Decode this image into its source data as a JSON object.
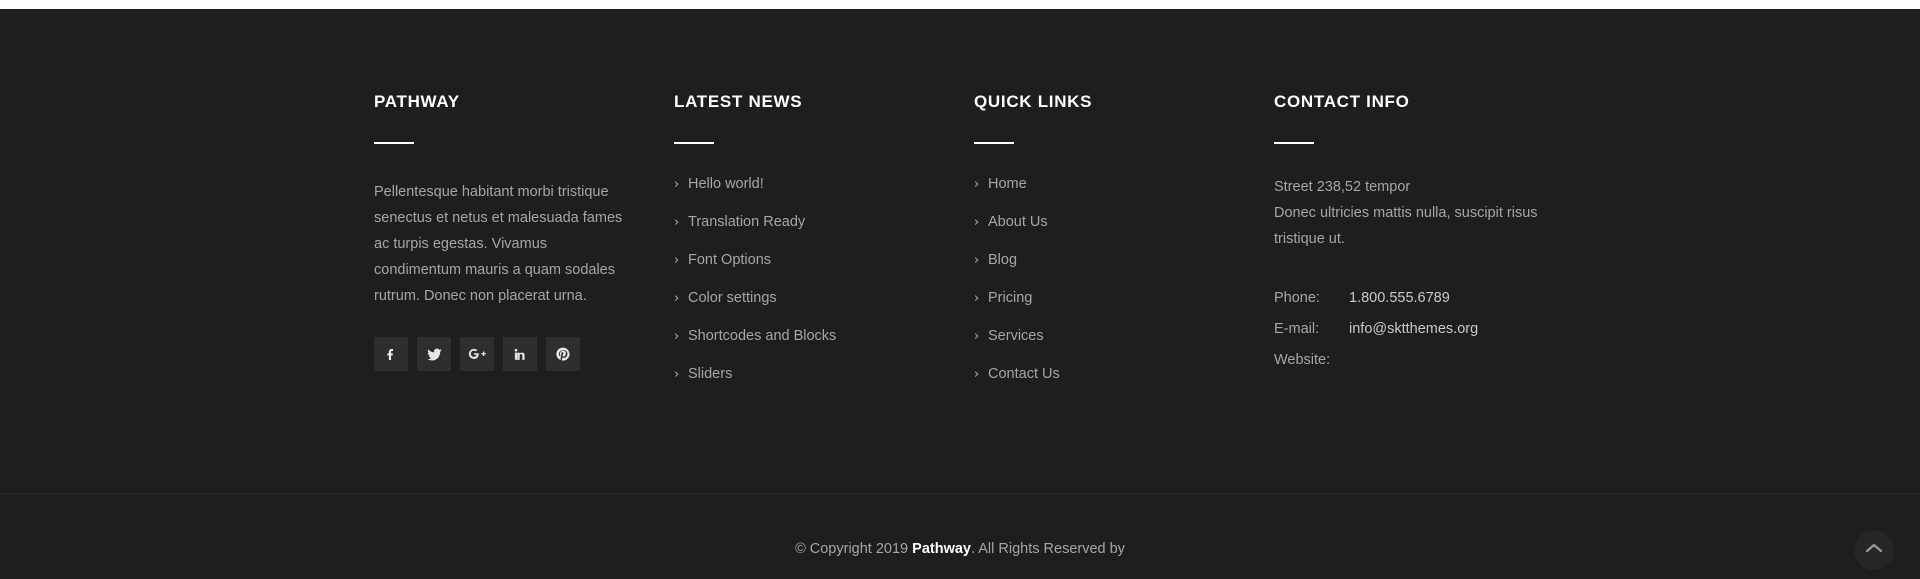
{
  "theme": {
    "footer_bg": "#1e1e1e",
    "social_tile_bg": "#2e2e2e",
    "text_muted": "#a6a6a6",
    "text_white": "#ffffff",
    "divider": "#2b2b2b"
  },
  "footer": {
    "brand": {
      "title": "PATHWAY",
      "description": "Pellentesque habitant morbi tristique senectus et netus et malesuada fames ac turpis egestas. Vivamus condimentum mauris a quam sodales rutrum. Donec non placerat urna.",
      "social": [
        {
          "name": "facebook-icon",
          "label": "Facebook"
        },
        {
          "name": "twitter-icon",
          "label": "Twitter"
        },
        {
          "name": "google-plus-icon",
          "label": "Google Plus"
        },
        {
          "name": "linkedin-icon",
          "label": "LinkedIn"
        },
        {
          "name": "pinterest-icon",
          "label": "Pinterest"
        }
      ]
    },
    "latest_news": {
      "title": "LATEST NEWS",
      "items": [
        {
          "label": "Hello world!"
        },
        {
          "label": "Translation Ready"
        },
        {
          "label": "Font Options"
        },
        {
          "label": "Color settings"
        },
        {
          "label": "Shortcodes and Blocks"
        },
        {
          "label": "Sliders"
        }
      ]
    },
    "quick_links": {
      "title": "QUICK LINKS",
      "items": [
        {
          "label": "Home"
        },
        {
          "label": "About Us"
        },
        {
          "label": "Blog"
        },
        {
          "label": "Pricing"
        },
        {
          "label": "Services"
        },
        {
          "label": "Contact Us"
        }
      ]
    },
    "contact_info": {
      "title": "CONTACT INFO",
      "address_line_1": "Street 238,52 tempor",
      "address_line_2": "Donec ultricies mattis nulla, suscipit risus tristique ut.",
      "rows": [
        {
          "key": "Phone:",
          "value": "1.800.555.6789"
        },
        {
          "key": "E-mail:",
          "value": "info@sktthemes.org"
        },
        {
          "key": "Website:",
          "value": ""
        }
      ]
    },
    "bottom": {
      "copyright_prefix": "© Copyright 2019 ",
      "copyright_brand": "Pathway",
      "copyright_suffix": ". All Rights Reserved by"
    },
    "scroll_top": {
      "label": "Back to top"
    },
    "chevron": "›"
  }
}
